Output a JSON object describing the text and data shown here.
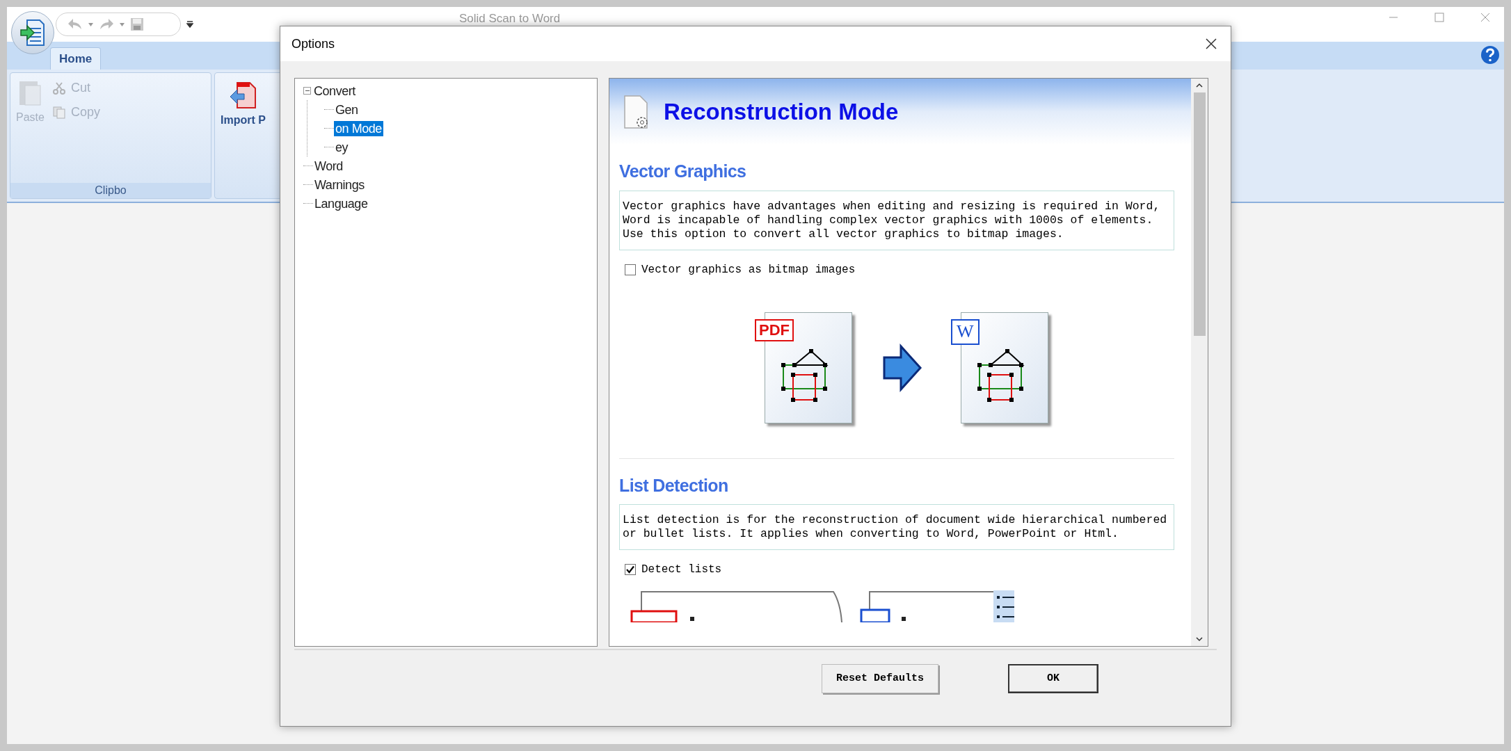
{
  "app": {
    "title": "Solid Scan to Word",
    "tabs": [
      {
        "label": "Home",
        "selected": true
      }
    ],
    "ribbon": {
      "clipboard": {
        "paste": {
          "label": "Paste",
          "disabled": true
        },
        "cut": {
          "label": "Cut",
          "disabled": true
        },
        "copy": {
          "label": "Copy",
          "disabled": true
        },
        "group_label": "Clipbo"
      },
      "import": {
        "label": "Import P"
      }
    }
  },
  "dialog": {
    "title": "Options",
    "tree": [
      {
        "label": "Convert",
        "expanded": true,
        "selected": false,
        "children": [
          {
            "label": "Gen",
            "selected": false
          },
          {
            "label": "on Mode",
            "selected": true
          },
          {
            "label": "ey",
            "selected": false
          }
        ]
      },
      {
        "label": "Word",
        "selected": false
      },
      {
        "label": "Warnings",
        "selected": false
      },
      {
        "label": "Language",
        "selected": false
      }
    ],
    "panel": {
      "title": "Reconstruction Mode",
      "sections": [
        {
          "kind": "vector",
          "heading": "Vector Graphics",
          "description": "Vector graphics have advantages when editing and resizing is required in Word, Word is incapable of handling complex vector graphics with 1000s of elements. Use this option to convert all vector graphics to bitmap images.",
          "checkbox": {
            "label": "Vector graphics as bitmap images",
            "checked": false
          },
          "source_label": "PDF",
          "target_label": "W"
        },
        {
          "kind": "list",
          "heading": "List Detection",
          "description": "List detection is for the reconstruction of document wide hierarchical numbered or bullet lists. It applies when converting to Word, PowerPoint or Html.",
          "checkbox": {
            "label": "Detect lists",
            "checked": true
          }
        }
      ]
    },
    "buttons": [
      {
        "label": "Reset Defaults",
        "default": false
      },
      {
        "label": "OK",
        "default": true
      }
    ]
  }
}
